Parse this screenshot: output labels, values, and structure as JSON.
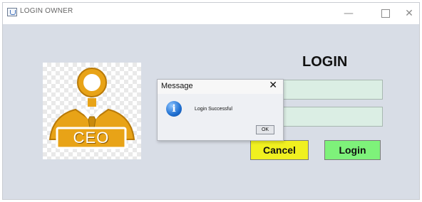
{
  "window": {
    "title": "LOGIN OWNER",
    "controls": {
      "minimize": "—",
      "close": "✕"
    }
  },
  "logo": {
    "text": "CEO",
    "icon": "ceo-person-icon",
    "accent": "#e8a317"
  },
  "form": {
    "heading": "LOGIN",
    "username_value": "",
    "password_value": "**",
    "cancel_label": "Cancel",
    "login_label": "Login",
    "cancel_color": "#f0f020",
    "login_color": "#7ef27a",
    "field_color": "#dbeee4"
  },
  "dialog": {
    "title": "Message",
    "close": "✕",
    "icon": "information-icon",
    "icon_glyph": "i",
    "message": "Login Successful",
    "ok_label": "OK"
  }
}
